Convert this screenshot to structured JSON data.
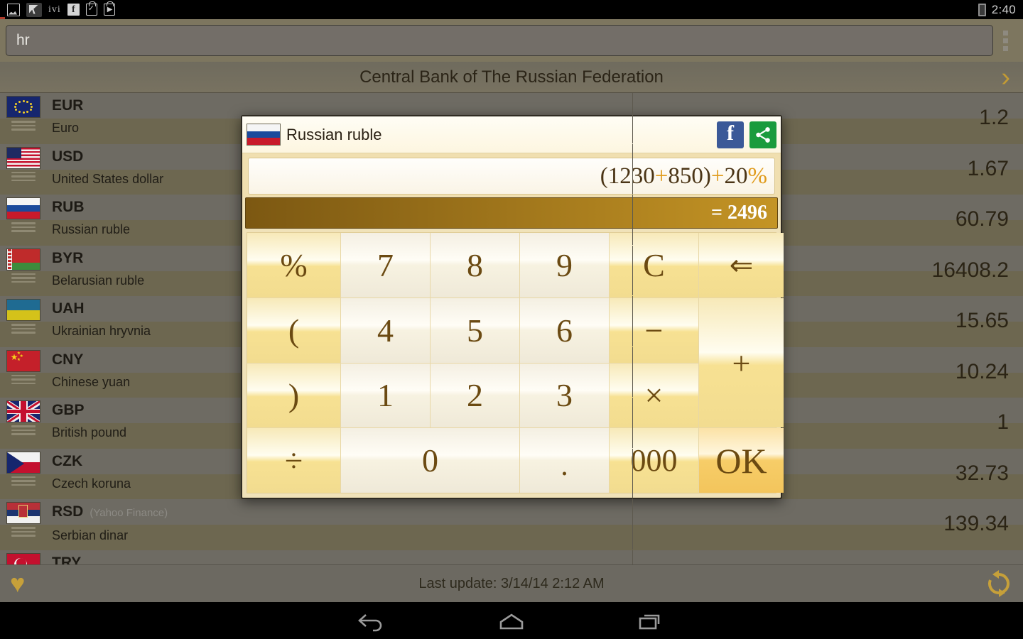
{
  "statusbar": {
    "icons": [
      "gallery-icon",
      "cursor-icon",
      "ivi-icon",
      "facebook-icon",
      "checkbag-icon",
      "playbag-icon"
    ],
    "ivi_label": "ivi",
    "facebook_label": "f",
    "time": "2:40",
    "battery": "battery-low-icon"
  },
  "search": {
    "value": "hr",
    "placeholder": "",
    "overflow_label": "overflow-menu"
  },
  "header": {
    "title": "Central Bank of The Russian Federation",
    "next_chevron": "›"
  },
  "list": {
    "rows": [
      {
        "code": "EUR",
        "name": "Euro",
        "value": "1.2",
        "source": "",
        "flag": "eu"
      },
      {
        "code": "USD",
        "name": "United States dollar",
        "value": "1.67",
        "source": "",
        "flag": "us"
      },
      {
        "code": "RUB",
        "name": "Russian ruble",
        "value": "60.79",
        "source": "",
        "flag": "ru"
      },
      {
        "code": "BYR",
        "name": "Belarusian ruble",
        "value": "16408.2",
        "source": "",
        "flag": "by"
      },
      {
        "code": "UAH",
        "name": "Ukrainian hryvnia",
        "value": "15.65",
        "source": "",
        "flag": "ua"
      },
      {
        "code": "CNY",
        "name": "Chinese yuan",
        "value": "10.24",
        "source": "",
        "flag": "cn"
      },
      {
        "code": "GBP",
        "name": "British pound",
        "value": "1",
        "source": "",
        "flag": "gb"
      },
      {
        "code": "CZK",
        "name": "Czech koruna",
        "value": "32.73",
        "source": "",
        "flag": "cz"
      },
      {
        "code": "RSD",
        "name": "Serbian dinar",
        "value": "139.34",
        "source": "(Yahoo Finance)",
        "flag": "rs"
      },
      {
        "code": "TRY",
        "name": "",
        "value": "",
        "source": "",
        "flag": "tr"
      }
    ]
  },
  "footer": {
    "last_update": "Last update: 3/14/14 2:12 AM",
    "favorite_icon": "heart-icon",
    "refresh_icon": "refresh-icon"
  },
  "navbar": {
    "back": "back-icon",
    "home": "home-icon",
    "recents": "recents-icon"
  },
  "dialog": {
    "title": "Russian ruble",
    "flag": "ru",
    "facebook_label": "f",
    "share_label": "share-icon",
    "expression_parts": [
      {
        "t": "(1230",
        "k": "num"
      },
      {
        "t": "+",
        "k": "op"
      },
      {
        "t": "850)",
        "k": "num"
      },
      {
        "t": "+",
        "k": "op"
      },
      {
        "t": "20",
        "k": "num"
      },
      {
        "t": "%",
        "k": "op"
      }
    ],
    "expression": "(1230+850)+20%",
    "result": "= 2496",
    "keys": [
      {
        "label": "%",
        "name": "percent",
        "kind": "op"
      },
      {
        "label": "7",
        "name": "seven",
        "kind": "digit"
      },
      {
        "label": "8",
        "name": "eight",
        "kind": "digit"
      },
      {
        "label": "9",
        "name": "nine",
        "kind": "digit"
      },
      {
        "label": "C",
        "name": "clear",
        "kind": "op"
      },
      {
        "label": "⇐",
        "name": "backspace",
        "kind": "op"
      },
      {
        "label": "(",
        "name": "open-paren",
        "kind": "op"
      },
      {
        "label": "4",
        "name": "four",
        "kind": "digit"
      },
      {
        "label": "5",
        "name": "five",
        "kind": "digit"
      },
      {
        "label": "6",
        "name": "six",
        "kind": "digit"
      },
      {
        "label": "−",
        "name": "minus",
        "kind": "op"
      },
      {
        "label": "+",
        "name": "plus",
        "kind": "op"
      },
      {
        "label": ")",
        "name": "close-paren",
        "kind": "op"
      },
      {
        "label": "1",
        "name": "one",
        "kind": "digit"
      },
      {
        "label": "2",
        "name": "two",
        "kind": "digit"
      },
      {
        "label": "3",
        "name": "three",
        "kind": "digit"
      },
      {
        "label": "×",
        "name": "multiply",
        "kind": "op"
      },
      {
        "label": "÷",
        "name": "divide",
        "kind": "op"
      },
      {
        "label": "0",
        "name": "zero",
        "kind": "digit"
      },
      {
        "label": ".",
        "name": "decimal",
        "kind": "digit"
      },
      {
        "label": "000",
        "name": "triple-zero",
        "kind": "op"
      },
      {
        "label": "OK",
        "name": "ok",
        "kind": "ok"
      }
    ]
  },
  "colors": {
    "accent_gold": "#c49425",
    "facebook_blue": "#3b5998",
    "share_green": "#1a9b3d",
    "operator_orange": "#e09b1c",
    "number_brown": "#4a3415"
  }
}
